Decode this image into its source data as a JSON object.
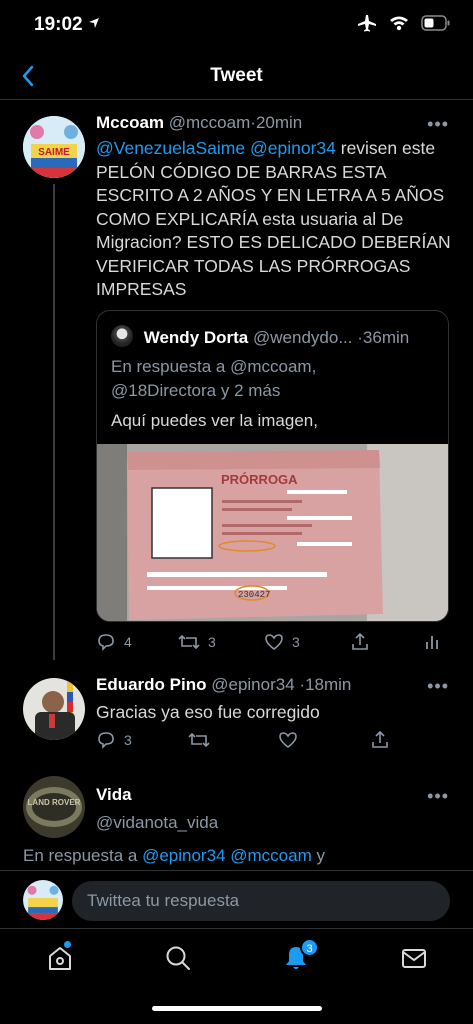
{
  "status": {
    "time": "19:02"
  },
  "nav": {
    "title": "Tweet"
  },
  "main_tweet": {
    "name": "Mccoam",
    "handle": "@mccoam",
    "separator": "·",
    "time": "20min",
    "mention1": "@VenezuelaSaime",
    "mention2": "@epinor34",
    "text": " revisen este PELÓN CÓDIGO DE BARRAS ESTA ESCRITO A 2 AÑOS Y EN LETRA A 5 AÑOS COMO EXPLICARÍA esta usuaria al De Migracion? ESTO ES DELICADO DEBERÍAN VERIFICAR TODAS LAS PRÓRROGAS IMPRESAS",
    "avatar_text": "SAIME"
  },
  "quote": {
    "name": "Wendy Dorta",
    "handle": "@wendydo...",
    "separator": "·",
    "time": "36min",
    "reply_line1": "En respuesta a @mccoam,",
    "reply_line2": "@18Directora y 2 más",
    "text": "Aquí puedes ver la imagen,",
    "document_title": "PRÓRROGA",
    "document_number": "230427"
  },
  "main_actions": {
    "replies": "4",
    "retweets": "3",
    "likes": "3"
  },
  "reply_tweet": {
    "name": "Eduardo Pino",
    "handle": "@epinor34",
    "separator": "·",
    "time": "18min",
    "text": "Gracias ya eso fue corregido",
    "replies": "3"
  },
  "third_tweet": {
    "name": "Vida",
    "handle": "@vidanota_vida",
    "avatar_text": "LAND ROVER"
  },
  "reply_context": {
    "prefix": "En respuesta a ",
    "mention1": "@epinor34",
    "mention2": "@mccoam",
    "suffix": " y"
  },
  "compose": {
    "placeholder": "Twittea tu respuesta"
  },
  "tabs": {
    "notifications_badge": "3"
  },
  "colors": {
    "accent": "#1d9bf0",
    "background": "#000000",
    "muted": "#8b98a5"
  }
}
